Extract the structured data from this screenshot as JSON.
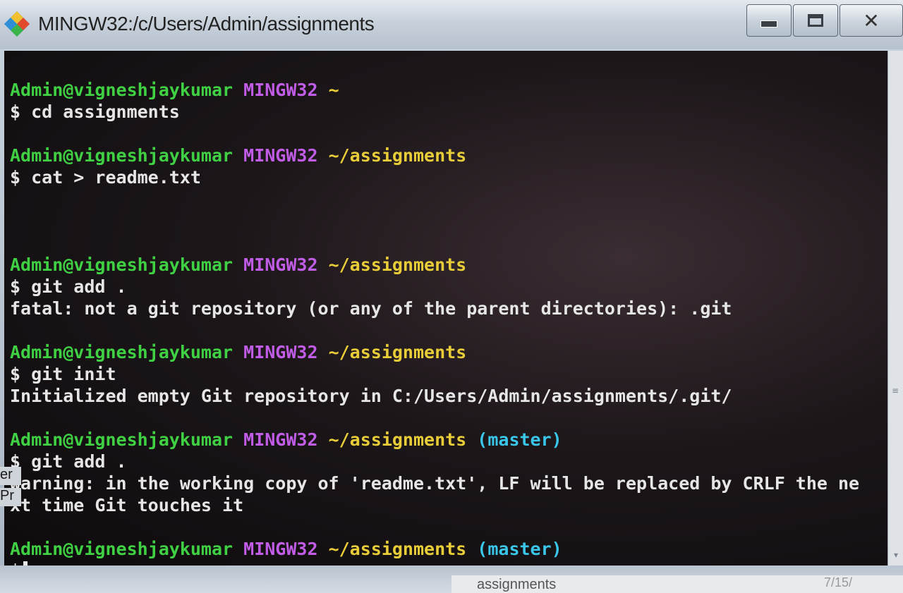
{
  "window": {
    "title": "MINGW32:/c/Users/Admin/assignments",
    "icon": "git-bash-icon",
    "buttons": {
      "minimize": "minimize-icon",
      "maximize": "maximize-icon",
      "close": "✕"
    }
  },
  "colors": {
    "user": "#3fd143",
    "host": "#c05ce6",
    "path": "#e8cd38",
    "branch": "#3ac6e8",
    "text": "#e6e6e6"
  },
  "terminal": {
    "blocks": [
      {
        "user": "Admin@vigneshjaykumar",
        "host": "MINGW32",
        "path": "~",
        "branch": "",
        "command": "$ cd assignments",
        "output": []
      },
      {
        "user": "Admin@vigneshjaykumar",
        "host": "MINGW32",
        "path": "~/assignments",
        "branch": "",
        "command": "$ cat > readme.txt",
        "output": []
      },
      {
        "user": "Admin@vigneshjaykumar",
        "host": "MINGW32",
        "path": "~/assignments",
        "branch": "",
        "command": "$ git add .",
        "output": [
          "fatal: not a git repository (or any of the parent directories): .git"
        ]
      },
      {
        "user": "Admin@vigneshjaykumar",
        "host": "MINGW32",
        "path": "~/assignments",
        "branch": "",
        "command": "$ git init",
        "output": [
          "Initialized empty Git repository in C:/Users/Admin/assignments/.git/"
        ]
      },
      {
        "user": "Admin@vigneshjaykumar",
        "host": "MINGW32",
        "path": "~/assignments",
        "branch": "(master)",
        "command": "$ git add .",
        "output": [
          "warning: in the working copy of 'readme.txt', LF will be replaced by CRLF the ne",
          "xt time Git touches it"
        ]
      },
      {
        "user": "Admin@vigneshjaykumar",
        "host": "MINGW32",
        "path": "~/assignments",
        "branch": "(master)",
        "command": "$",
        "output": []
      }
    ]
  },
  "background": {
    "taskbar_label": "assignments",
    "taskbar_date": "7/15/",
    "side_clip_1": "er",
    "side_clip_2": "Pr"
  }
}
